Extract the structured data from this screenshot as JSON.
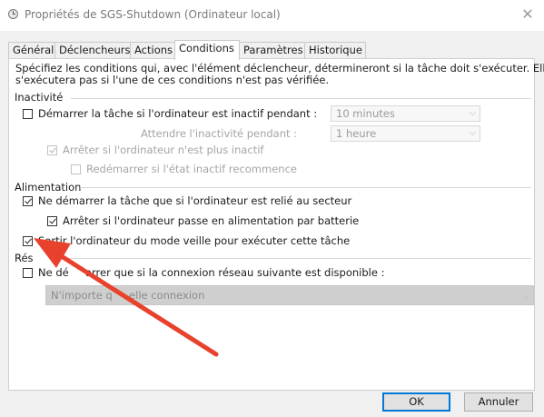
{
  "window": {
    "title": "Propriétés de SGS-Shutdown (Ordinateur local)",
    "close_glyph": "✕"
  },
  "tabs": [
    {
      "label": "Général",
      "active": false
    },
    {
      "label": "Déclencheurs",
      "active": false
    },
    {
      "label": "Actions",
      "active": false
    },
    {
      "label": "Conditions",
      "active": true
    },
    {
      "label": "Paramètres",
      "active": false
    },
    {
      "label": "Historique",
      "active": false
    }
  ],
  "intro": {
    "line1": "Spécifiez les conditions qui, avec l'élément déclencheur, détermineront si la tâche doit s'exécuter. Elle ne",
    "line2": "s'exécutera pas si l'une de ces conditions n'est pas vérifiée."
  },
  "idle": {
    "group_label": "Inactivité",
    "start_if_idle": {
      "label": "Démarrer la tâche si l'ordinateur est inactif pendant :",
      "checked": false
    },
    "idle_duration": {
      "value": "10 minutes"
    },
    "wait_label": "Attendre l'inactivité pendant :",
    "wait_duration": {
      "value": "1 heure"
    },
    "stop_if_not_idle": {
      "label": "Arrêter si l'ordinateur n'est plus inactif",
      "checked": true,
      "disabled": true
    },
    "restart_if_idle": {
      "label": "Redémarrer si l'état inactif recommence",
      "checked": false,
      "disabled": true
    }
  },
  "power": {
    "group_label": "Alimentation",
    "ac_only": {
      "label": "Ne démarrer la tâche que si l'ordinateur est relié au secteur",
      "checked": true
    },
    "stop_on_battery": {
      "label": "Arrêter si l'ordinateur passe en alimentation par batterie",
      "checked": true
    },
    "wake_to_run": {
      "label": "Sortir l'ordinateur du mode veille pour exécuter cette tâche",
      "checked": true
    }
  },
  "network": {
    "group_label": "Rés",
    "only_if_network": {
      "label": "Ne dé     arrer que si la connexion réseau suivante est disponible :",
      "checked": false
    },
    "connection": {
      "value": "N'importe q     elle connexion"
    }
  },
  "buttons": {
    "ok": "OK",
    "cancel": "Annuler"
  },
  "annotation": {
    "color": "#e8412c"
  }
}
